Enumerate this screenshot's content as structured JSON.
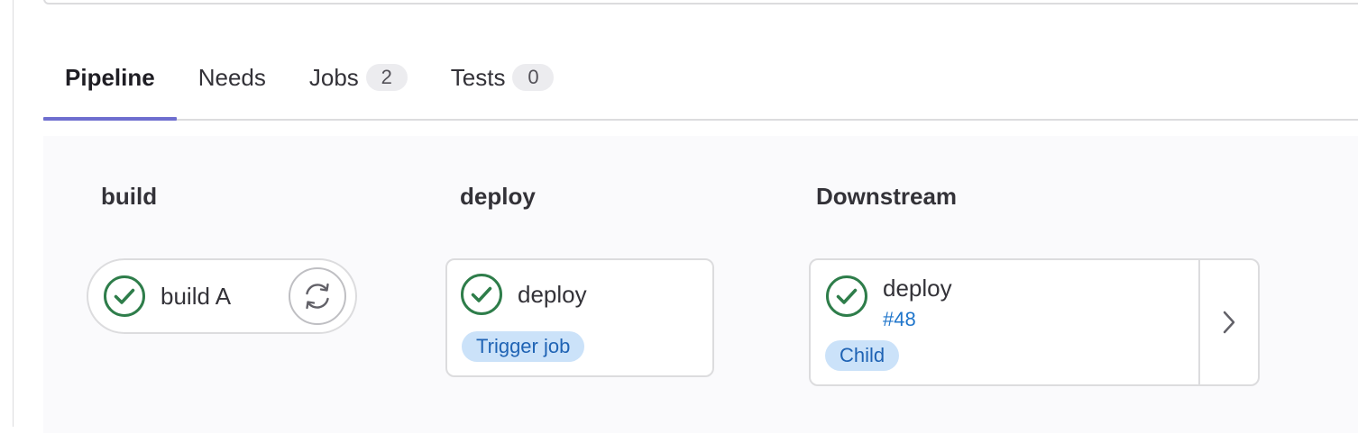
{
  "tabs": [
    {
      "label": "Pipeline",
      "badge": null
    },
    {
      "label": "Needs",
      "badge": null
    },
    {
      "label": "Jobs",
      "badge": "2"
    },
    {
      "label": "Tests",
      "badge": "0"
    }
  ],
  "active_tab": "Pipeline",
  "stages": [
    {
      "title": "build",
      "jobs": [
        {
          "name": "build A",
          "status": "success",
          "action": "retry-icon"
        }
      ]
    },
    {
      "title": "deploy",
      "jobs": [
        {
          "name": "deploy",
          "status": "success",
          "tag": "Trigger job"
        }
      ]
    },
    {
      "title": "Downstream",
      "jobs": [
        {
          "name": "deploy",
          "pipeline_id": "#48",
          "status": "success",
          "tag": "Child",
          "action": "chevron-right-icon"
        }
      ]
    }
  ],
  "colors": {
    "success": "#2e7d4a",
    "active_tab_underline": "#6e6ecf",
    "tag_bg": "#cbe2f9",
    "tag_text": "#1f63b4",
    "link": "#1f75cb"
  }
}
